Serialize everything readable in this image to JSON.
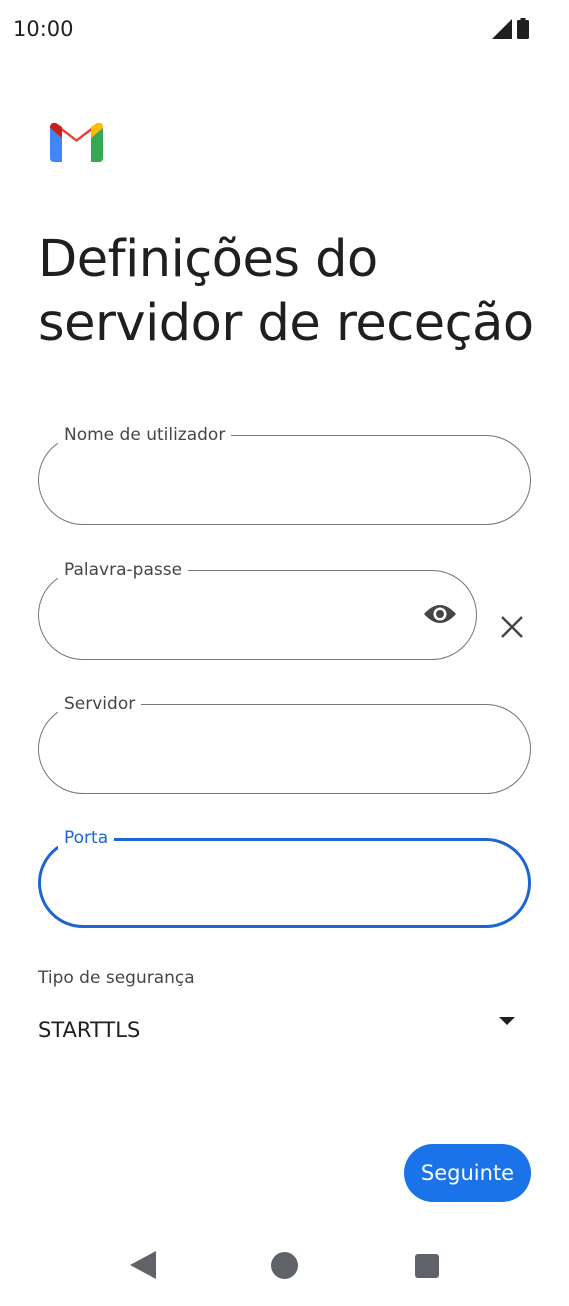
{
  "status_bar": {
    "time": "10:00",
    "icons": [
      "signal-icon",
      "battery-icon"
    ]
  },
  "app": {
    "logo_icon": "gmail-logo",
    "title": "Definições do servidor de receção"
  },
  "form": {
    "username": {
      "label": "Nome de utilizador",
      "value": ""
    },
    "password": {
      "label": "Palavra-passe",
      "value": "",
      "toggle_icon": "eye-icon",
      "clear_icon": "close-icon"
    },
    "server": {
      "label": "Servidor",
      "value": ""
    },
    "port": {
      "label": "Porta",
      "value": "",
      "focused": true
    },
    "security": {
      "label": "Tipo de segurança",
      "value": "STARTTLS"
    }
  },
  "actions": {
    "next_label": "Seguinte"
  },
  "nav": {
    "icons": [
      "back-icon",
      "home-icon",
      "recents-icon"
    ]
  },
  "colors": {
    "accent": "#1a73e8",
    "focus_outline": "#1a66d2",
    "outline": "#747775",
    "text": "#1f1f1f"
  }
}
